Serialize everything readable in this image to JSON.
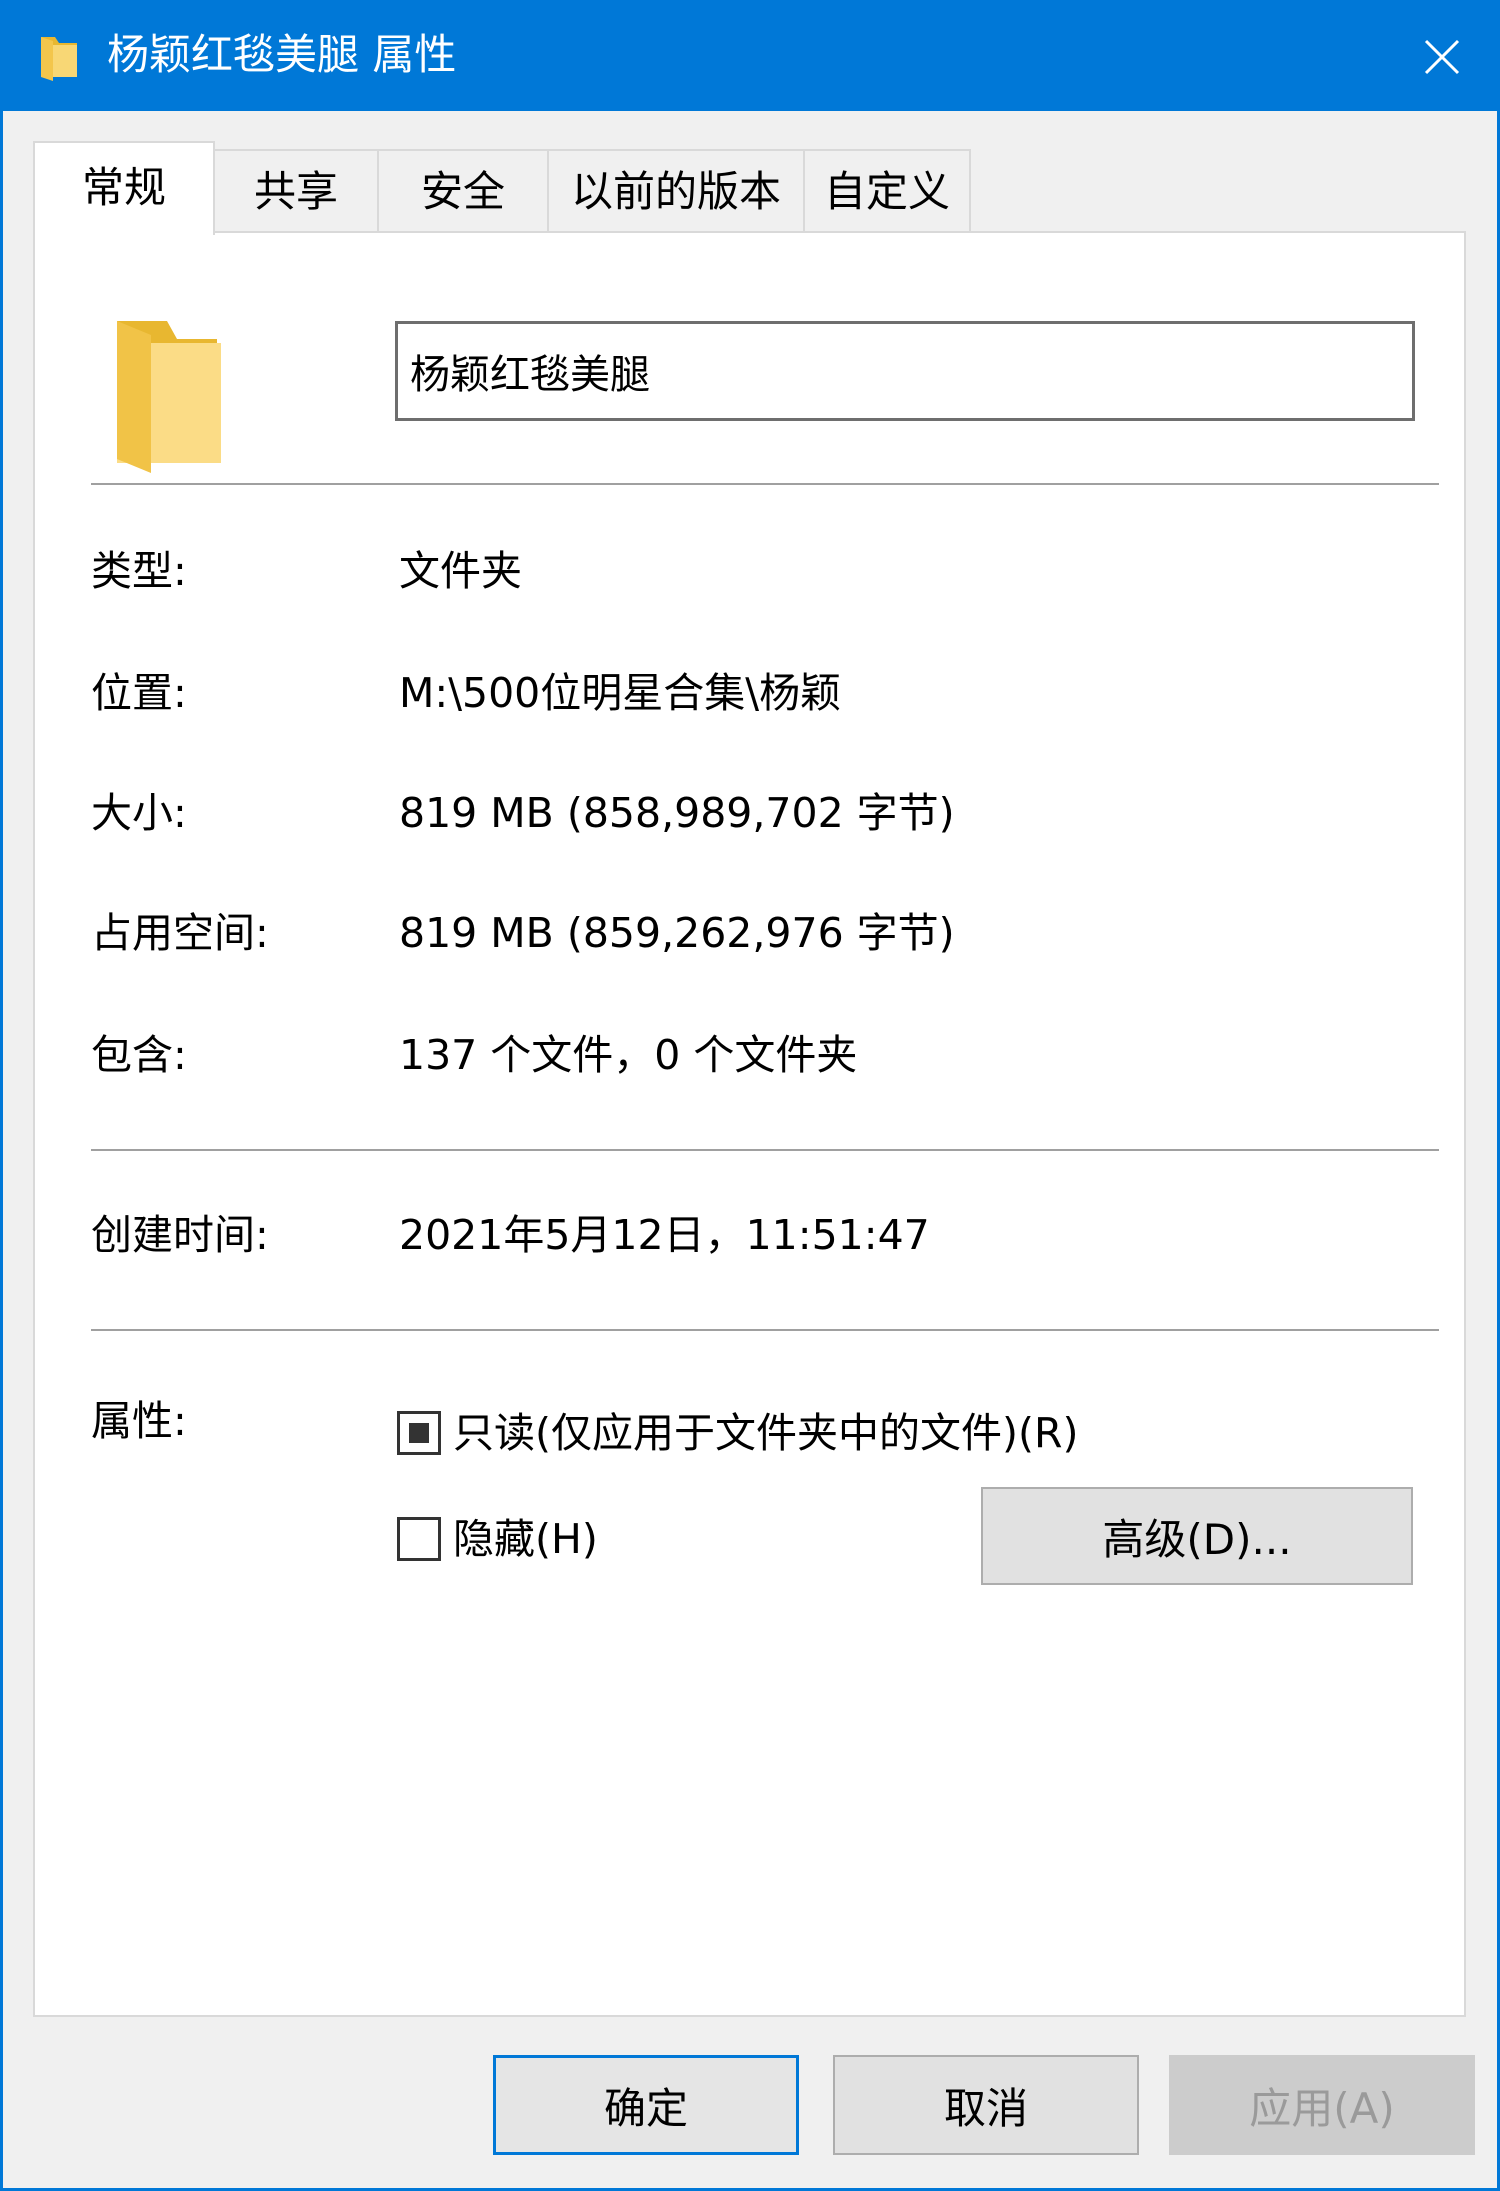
{
  "window": {
    "title": "杨颖红毯美腿 属性",
    "icon": "folder-icon",
    "close_icon": "close-icon"
  },
  "tabs": [
    {
      "label": "常规",
      "active": true
    },
    {
      "label": "共享",
      "active": false
    },
    {
      "label": "安全",
      "active": false
    },
    {
      "label": "以前的版本",
      "active": false
    },
    {
      "label": "自定义",
      "active": false
    }
  ],
  "general": {
    "folder_name": "杨颖红毯美腿",
    "type_label": "类型:",
    "type_value": "文件夹",
    "location_label": "位置:",
    "location_value": "M:\\500位明星合集\\杨颖",
    "size_label": "大小:",
    "size_value": "819 MB (858,989,702 字节)",
    "disk_size_label": "占用空间:",
    "disk_size_value": "819 MB (859,262,976 字节)",
    "contains_label": "包含:",
    "contains_value": "137 个文件，0 个文件夹",
    "created_label": "创建时间:",
    "created_value": "2021年5月12日，11:51:47",
    "attributes_label": "属性:",
    "readonly_label": "只读(仅应用于文件夹中的文件)(R)",
    "readonly_state": "indeterminate",
    "hidden_label": "隐藏(H)",
    "hidden_checked": false,
    "advanced_button": "高级(D)..."
  },
  "footer": {
    "ok": "确定",
    "cancel": "取消",
    "apply": "应用(A)"
  },
  "colors": {
    "accent": "#0078d7",
    "folder": "#f5c842"
  }
}
